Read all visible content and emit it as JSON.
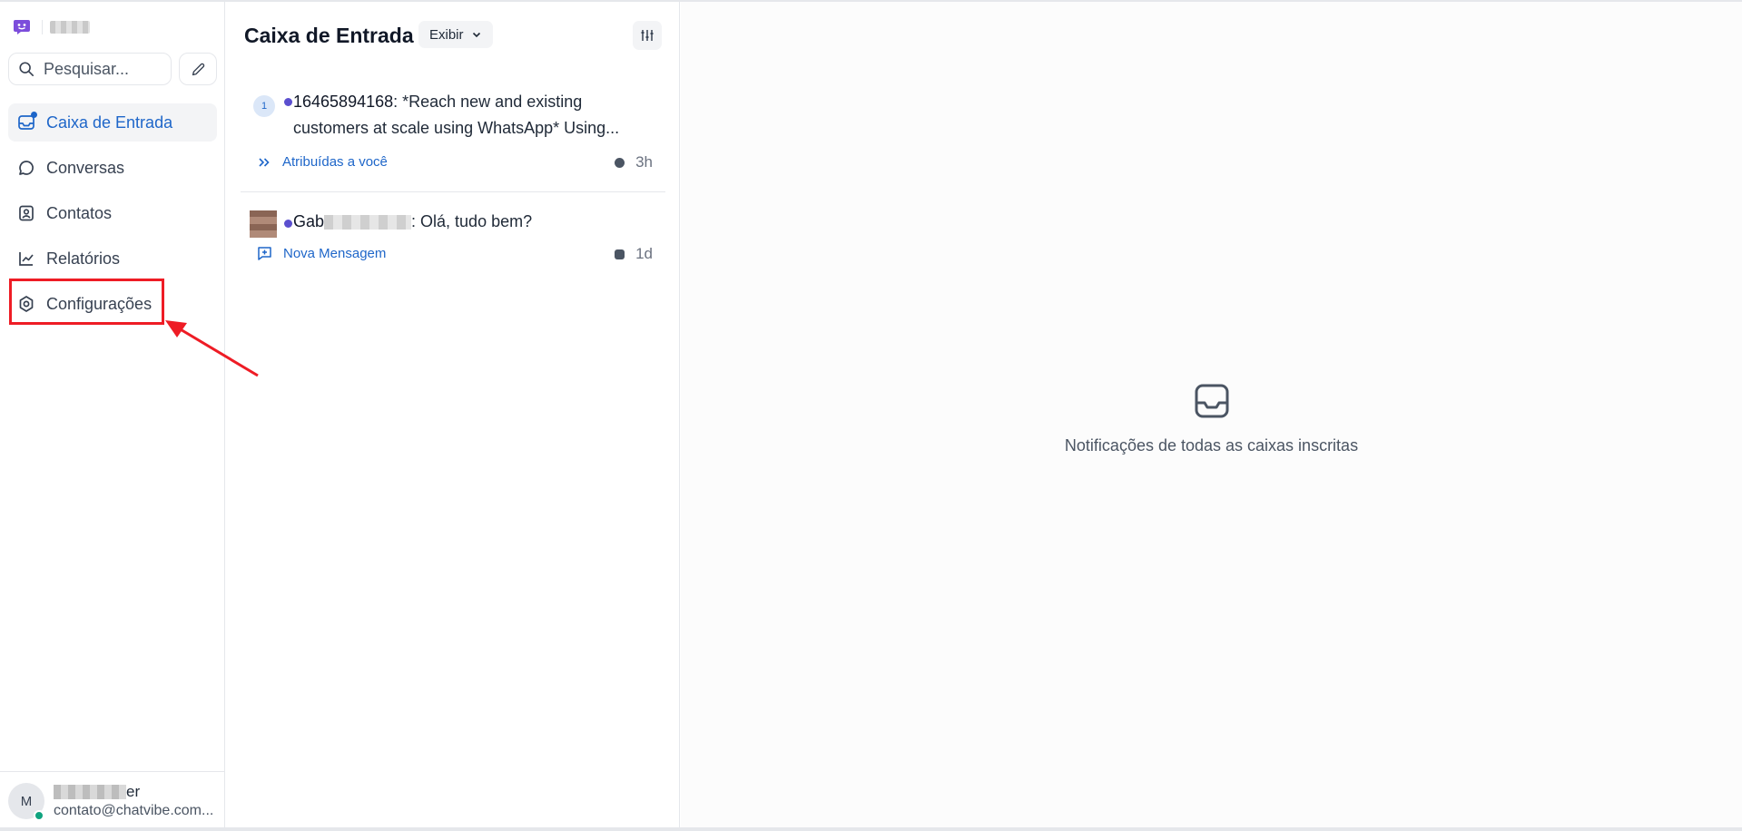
{
  "sidebar": {
    "search_placeholder": "Pesquisar...",
    "items": [
      {
        "label": "Caixa de Entrada",
        "icon": "inbox-icon",
        "active": true
      },
      {
        "label": "Conversas",
        "icon": "chat-bubble-icon"
      },
      {
        "label": "Contatos",
        "icon": "contact-card-icon"
      },
      {
        "label": "Relatórios",
        "icon": "chart-line-icon"
      },
      {
        "label": "Configurações",
        "icon": "gear-icon"
      }
    ],
    "profile": {
      "avatar_initial": "M",
      "name_suffix": "er",
      "email": "contato@chatvibe.com..."
    }
  },
  "list": {
    "title": "Caixa de Entrada",
    "view_label": "Exibir",
    "conversations": [
      {
        "badge": "1",
        "sender": "16465894168",
        "preview_line1": ": *Reach new and existing",
        "preview_line2": "customers at scale using WhatsApp* Using...",
        "meta_label": "Atribuídas a você",
        "time": "3h",
        "channel_icon": "whatsapp-icon"
      },
      {
        "sender_prefix": "Gab",
        "preview": ": Olá, tudo bem?",
        "meta_label": "Nova Mensagem",
        "time": "1d",
        "channel_icon": "instagram-icon"
      }
    ]
  },
  "detail": {
    "empty_text": "Notificações de todas as caixas inscritas"
  },
  "colors": {
    "accent": "#1e66c9",
    "unread_dot": "#5b4fcf",
    "annotation_red": "#ee1c25",
    "online": "#10a37f"
  }
}
